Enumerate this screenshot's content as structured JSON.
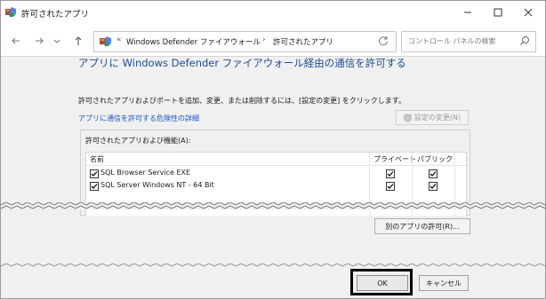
{
  "window": {
    "title": "許可されたアプリ"
  },
  "nav": {
    "crumb_root": "Windows Defender ファイアウォール",
    "crumb_current": "許可されたアプリ",
    "search_placeholder": "コントロール パネルの検索"
  },
  "main": {
    "heading": "アプリに Windows Defender ファイアウォール経由の通信を許可する",
    "description": "許可されたアプリおよびポートを追加、変更、または削除するには、[設定の変更] をクリックします。",
    "risk_link": "アプリに通信を許可する危険性の詳細",
    "change_settings": "設定の変更(N)",
    "group_label": "許可されたアプリおよび機能(A):",
    "columns": {
      "name": "名前",
      "private": "プライベート",
      "public": "パブリック"
    },
    "rows": [
      {
        "name": "SQL Browser Service EXE",
        "checked": true,
        "private": true,
        "public": true
      },
      {
        "name": "SQL Server Windows NT - 64 Bit",
        "checked": true,
        "private": true,
        "public": true
      }
    ],
    "allow_other_app": "別のアプリの許可(R)..."
  },
  "footer": {
    "ok": "OK",
    "cancel": "キャンセル"
  },
  "icons": {
    "window": "firewall-app-icon",
    "back": "back-arrow-icon",
    "forward": "forward-arrow-icon",
    "recent": "chevron-down-icon",
    "up": "up-arrow-icon",
    "refresh": "refresh-icon",
    "search": "search-icon",
    "shield": "shield-icon"
  },
  "colors": {
    "heading": "#1c4d96",
    "link": "#1a56c6",
    "highlight_border": "#000000"
  }
}
